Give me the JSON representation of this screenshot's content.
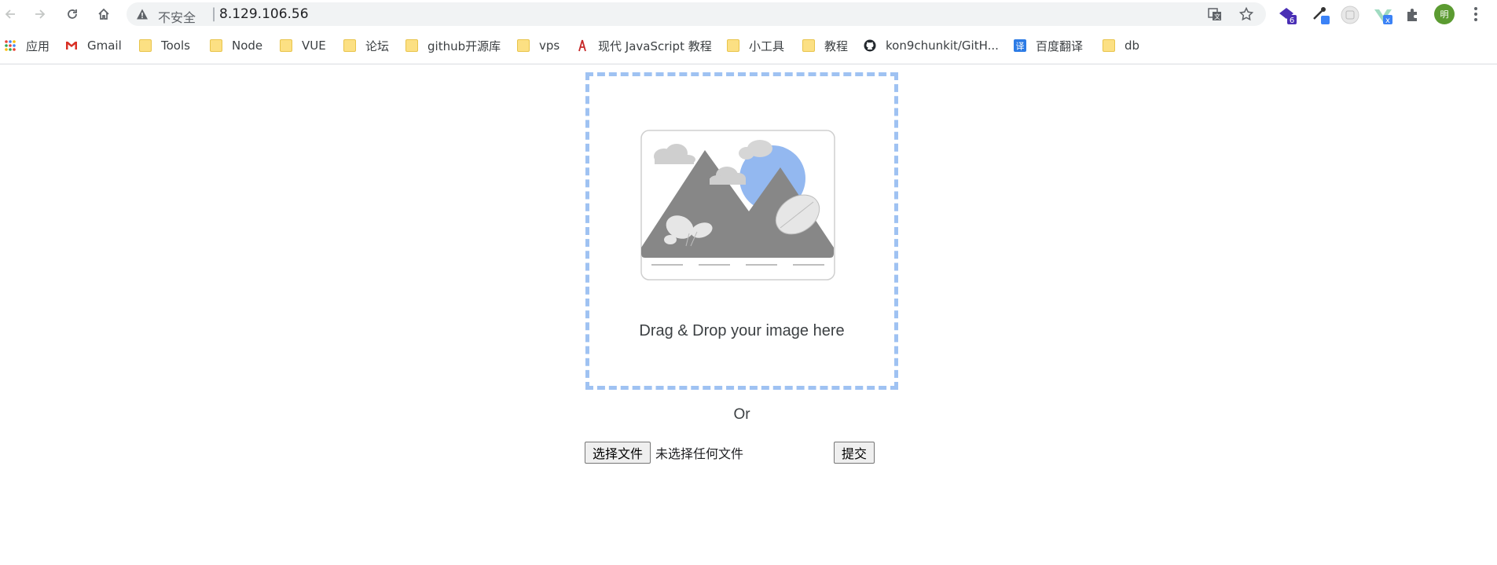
{
  "browser": {
    "security_label": "不安全",
    "separator": "|",
    "url": "8.129.106.56",
    "extension_badges": [
      "6",
      "x"
    ],
    "avatar_char": "明"
  },
  "bookmarks": [
    {
      "label": "应用",
      "icon": "apps-grid-icon"
    },
    {
      "label": "Gmail",
      "icon": "gmail-icon"
    },
    {
      "label": "Tools",
      "icon": "folder-icon"
    },
    {
      "label": "Node",
      "icon": "folder-icon"
    },
    {
      "label": "VUE",
      "icon": "folder-icon"
    },
    {
      "label": "论坛",
      "icon": "folder-icon"
    },
    {
      "label": "github开源库",
      "icon": "folder-icon"
    },
    {
      "label": "vps",
      "icon": "folder-icon"
    },
    {
      "label": "现代 JavaScript 教程",
      "icon": "javascript-info-icon"
    },
    {
      "label": "小工具",
      "icon": "folder-icon"
    },
    {
      "label": "教程",
      "icon": "folder-icon"
    },
    {
      "label": "kon9chunkit/GitH...",
      "icon": "github-icon"
    },
    {
      "label": "百度翻译",
      "icon": "baidu-translate-icon"
    },
    {
      "label": "db",
      "icon": "folder-icon"
    }
  ],
  "upload": {
    "drop_text": "Drag & Drop your image here",
    "or_text": "Or",
    "choose_button": "选择文件",
    "file_status": "未选择任何文件",
    "submit_button": "提交"
  },
  "colors": {
    "dropzone_border": "#9fc2f2",
    "mountain": "#878787",
    "sun": "#93b8f0",
    "cloud": "#cfcfcf"
  }
}
